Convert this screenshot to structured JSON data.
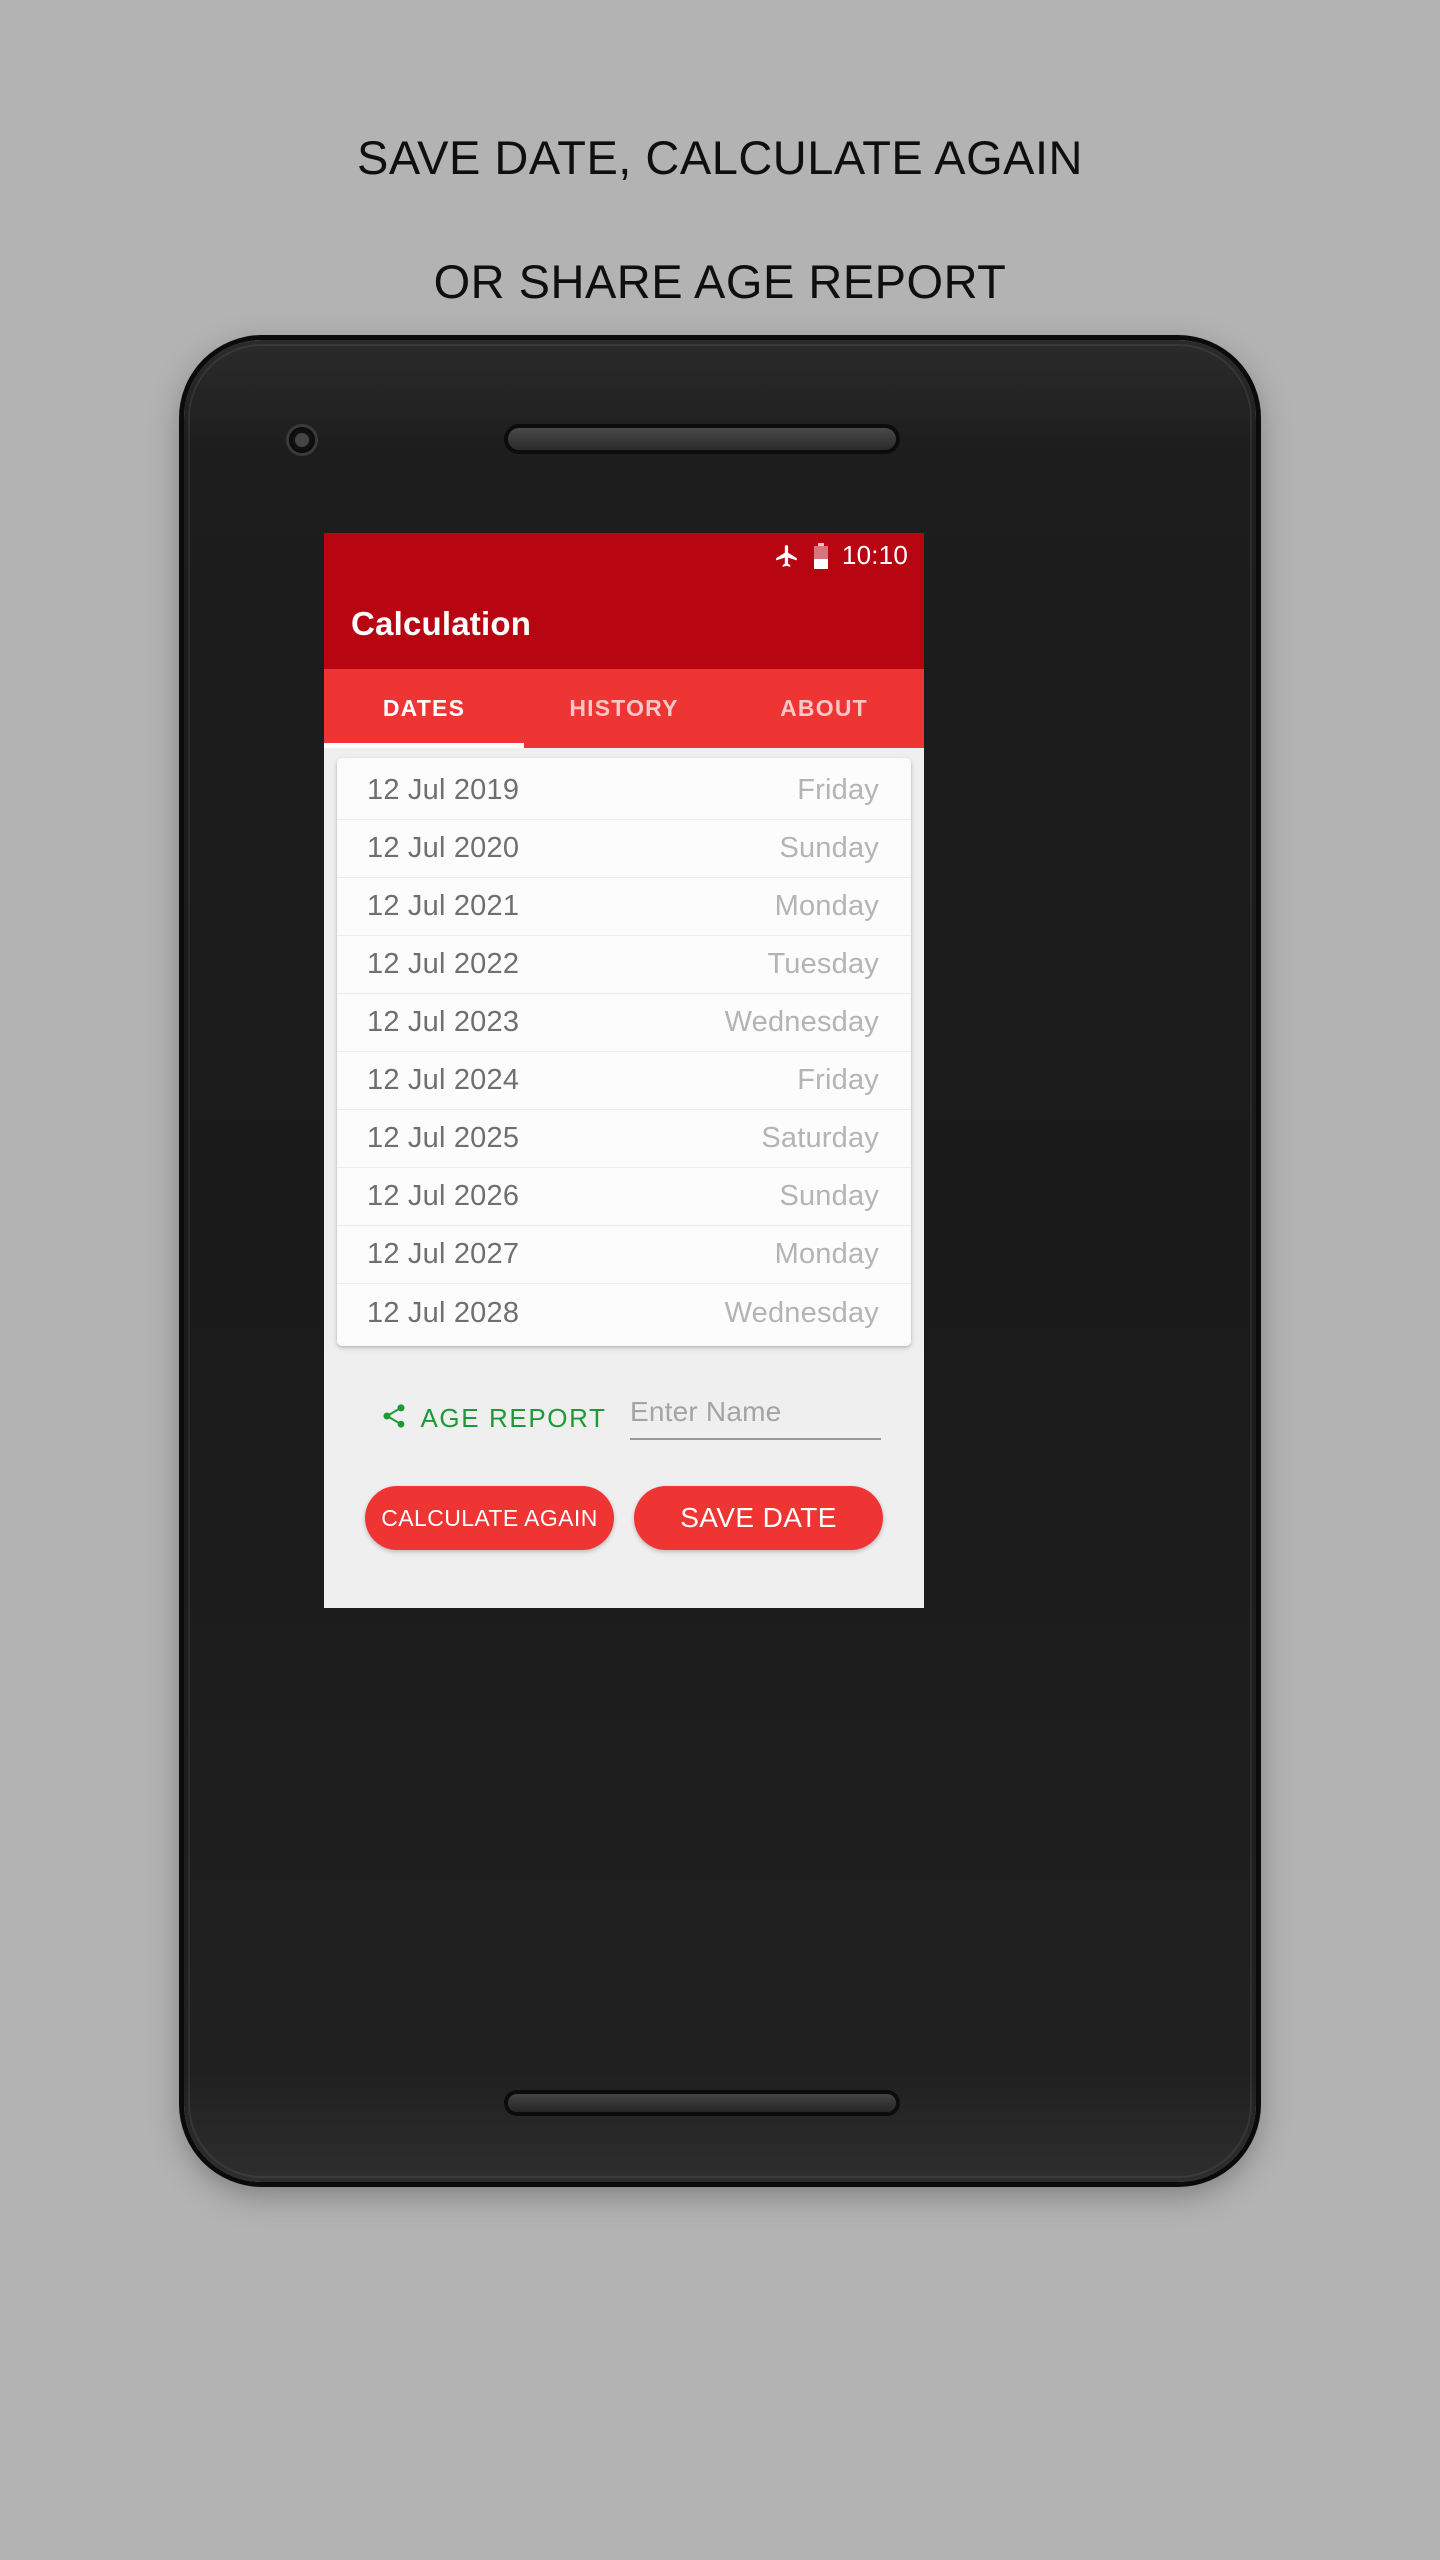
{
  "headline": {
    "line1": "SAVE DATE, CALCULATE AGAIN",
    "line2": "OR SHARE AGE REPORT"
  },
  "statusbar": {
    "airplane_icon": "airplane-icon",
    "battery_icon": "battery-icon",
    "time": "10:10"
  },
  "appbar": {
    "title": "Calculation"
  },
  "tabs": [
    {
      "label": "DATES",
      "active": true
    },
    {
      "label": "HISTORY",
      "active": false
    },
    {
      "label": "ABOUT",
      "active": false
    }
  ],
  "date_list": [
    {
      "date": "12 Jul 2019",
      "day": "Friday"
    },
    {
      "date": "12 Jul 2020",
      "day": "Sunday"
    },
    {
      "date": "12 Jul 2021",
      "day": "Monday"
    },
    {
      "date": "12 Jul 2022",
      "day": "Tuesday"
    },
    {
      "date": "12 Jul 2023",
      "day": "Wednesday"
    },
    {
      "date": "12 Jul 2024",
      "day": "Friday"
    },
    {
      "date": "12 Jul 2025",
      "day": "Saturday"
    },
    {
      "date": "12 Jul 2026",
      "day": "Sunday"
    },
    {
      "date": "12 Jul 2027",
      "day": "Monday"
    },
    {
      "date": "12 Jul 2028",
      "day": "Wednesday"
    }
  ],
  "actions": {
    "share_icon": "share-icon",
    "share_label": "AGE REPORT",
    "name_placeholder": "Enter Name",
    "name_value": "",
    "calculate_label": "CALCULATE AGAIN",
    "save_label": "SAVE DATE"
  },
  "colors": {
    "status_bar": "#b80512",
    "app_bar": "#b80512",
    "tab_bar": "#ef3434",
    "accent_button": "#ef3434",
    "share_green": "#1a9b35",
    "page_background": "#b3b3b3",
    "screen_background": "#efefef"
  }
}
